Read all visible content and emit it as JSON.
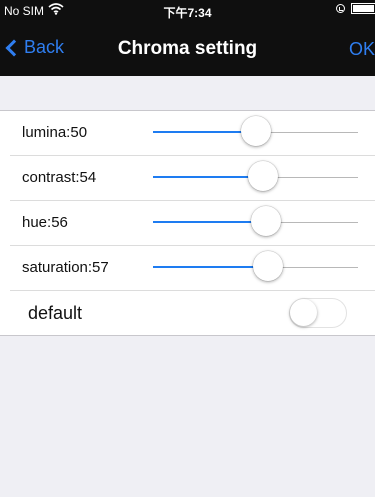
{
  "status_bar": {
    "carrier": "No SIM",
    "wifi_icon": "wifi-icon",
    "time": "下午7:34",
    "lock_icon": "orientation-lock-icon",
    "battery_icon": "battery-icon"
  },
  "nav": {
    "back_label": "Back",
    "title": "Chroma setting",
    "ok_label": "OK"
  },
  "settings": {
    "sliders": [
      {
        "label": "lumina:50",
        "value": 50
      },
      {
        "label": "contrast:54",
        "value": 54
      },
      {
        "label": "hue:56",
        "value": 56
      },
      {
        "label": "saturation:57",
        "value": 57
      }
    ],
    "default_label": "default",
    "default_on": false
  },
  "colors": {
    "accent": "#2f7ef0",
    "slider_fill": "#1e7cf1",
    "header_bg": "#0f0f0f",
    "page_bg": "#efeff4"
  }
}
